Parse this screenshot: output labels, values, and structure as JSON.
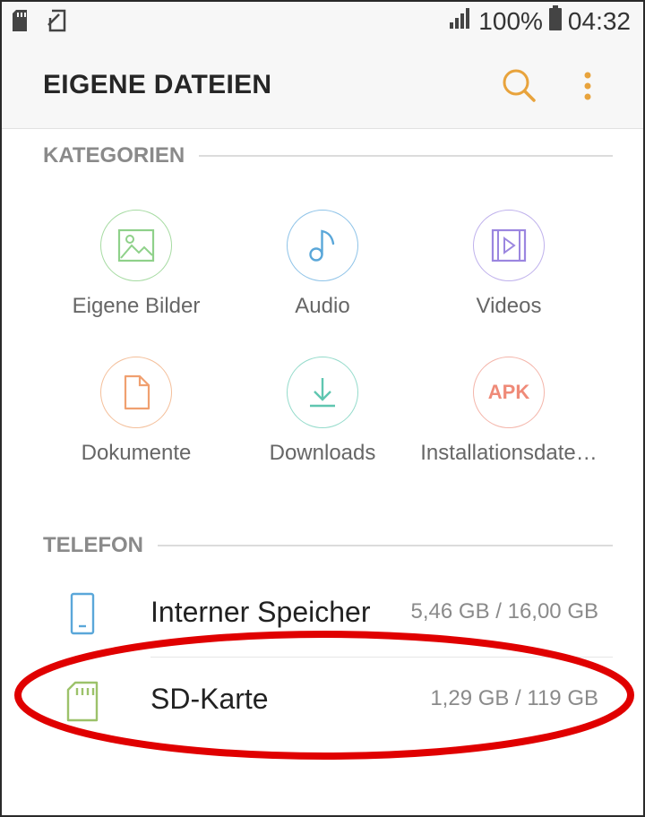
{
  "status_bar": {
    "battery_percent": "100%",
    "time": "04:32",
    "left_icons": [
      "sd-card-icon",
      "screenshot-icon"
    ],
    "right_icons": [
      "signal-icon",
      "battery-icon"
    ]
  },
  "app_bar": {
    "title": "EIGENE DATEIEN",
    "icons": [
      "search-icon",
      "more-vertical-icon"
    ],
    "accent_color": "#e8a33c"
  },
  "categories_section": {
    "title": "KATEGORIEN",
    "items": [
      {
        "label": "Eigene Bilder",
        "icon": "image-icon",
        "color": "#8fd18a"
      },
      {
        "label": "Audio",
        "icon": "music-note-icon",
        "color": "#5aa7d9"
      },
      {
        "label": "Videos",
        "icon": "video-icon",
        "color": "#9b86e0"
      },
      {
        "label": "Dokumente",
        "icon": "document-icon",
        "color": "#f0a070"
      },
      {
        "label": "Downloads",
        "icon": "download-icon",
        "color": "#5fc6b0"
      },
      {
        "label": "Installationsdate…",
        "icon": "apk-icon",
        "icon_text": "APK",
        "color": "#ef8a78"
      }
    ]
  },
  "phone_section": {
    "title": "TELEFON",
    "storage": [
      {
        "name": "Interner Speicher",
        "size": "5,46 GB / 16,00 GB",
        "icon": "phone-icon",
        "color": "#5aa7d9"
      },
      {
        "name": "SD-Karte",
        "size": "1,29 GB / 119 GB",
        "icon": "sd-card-icon",
        "color": "#9cc26a"
      }
    ]
  },
  "annotation": {
    "shape": "ellipse",
    "color": "#e00000",
    "target": "SD-Karte"
  }
}
